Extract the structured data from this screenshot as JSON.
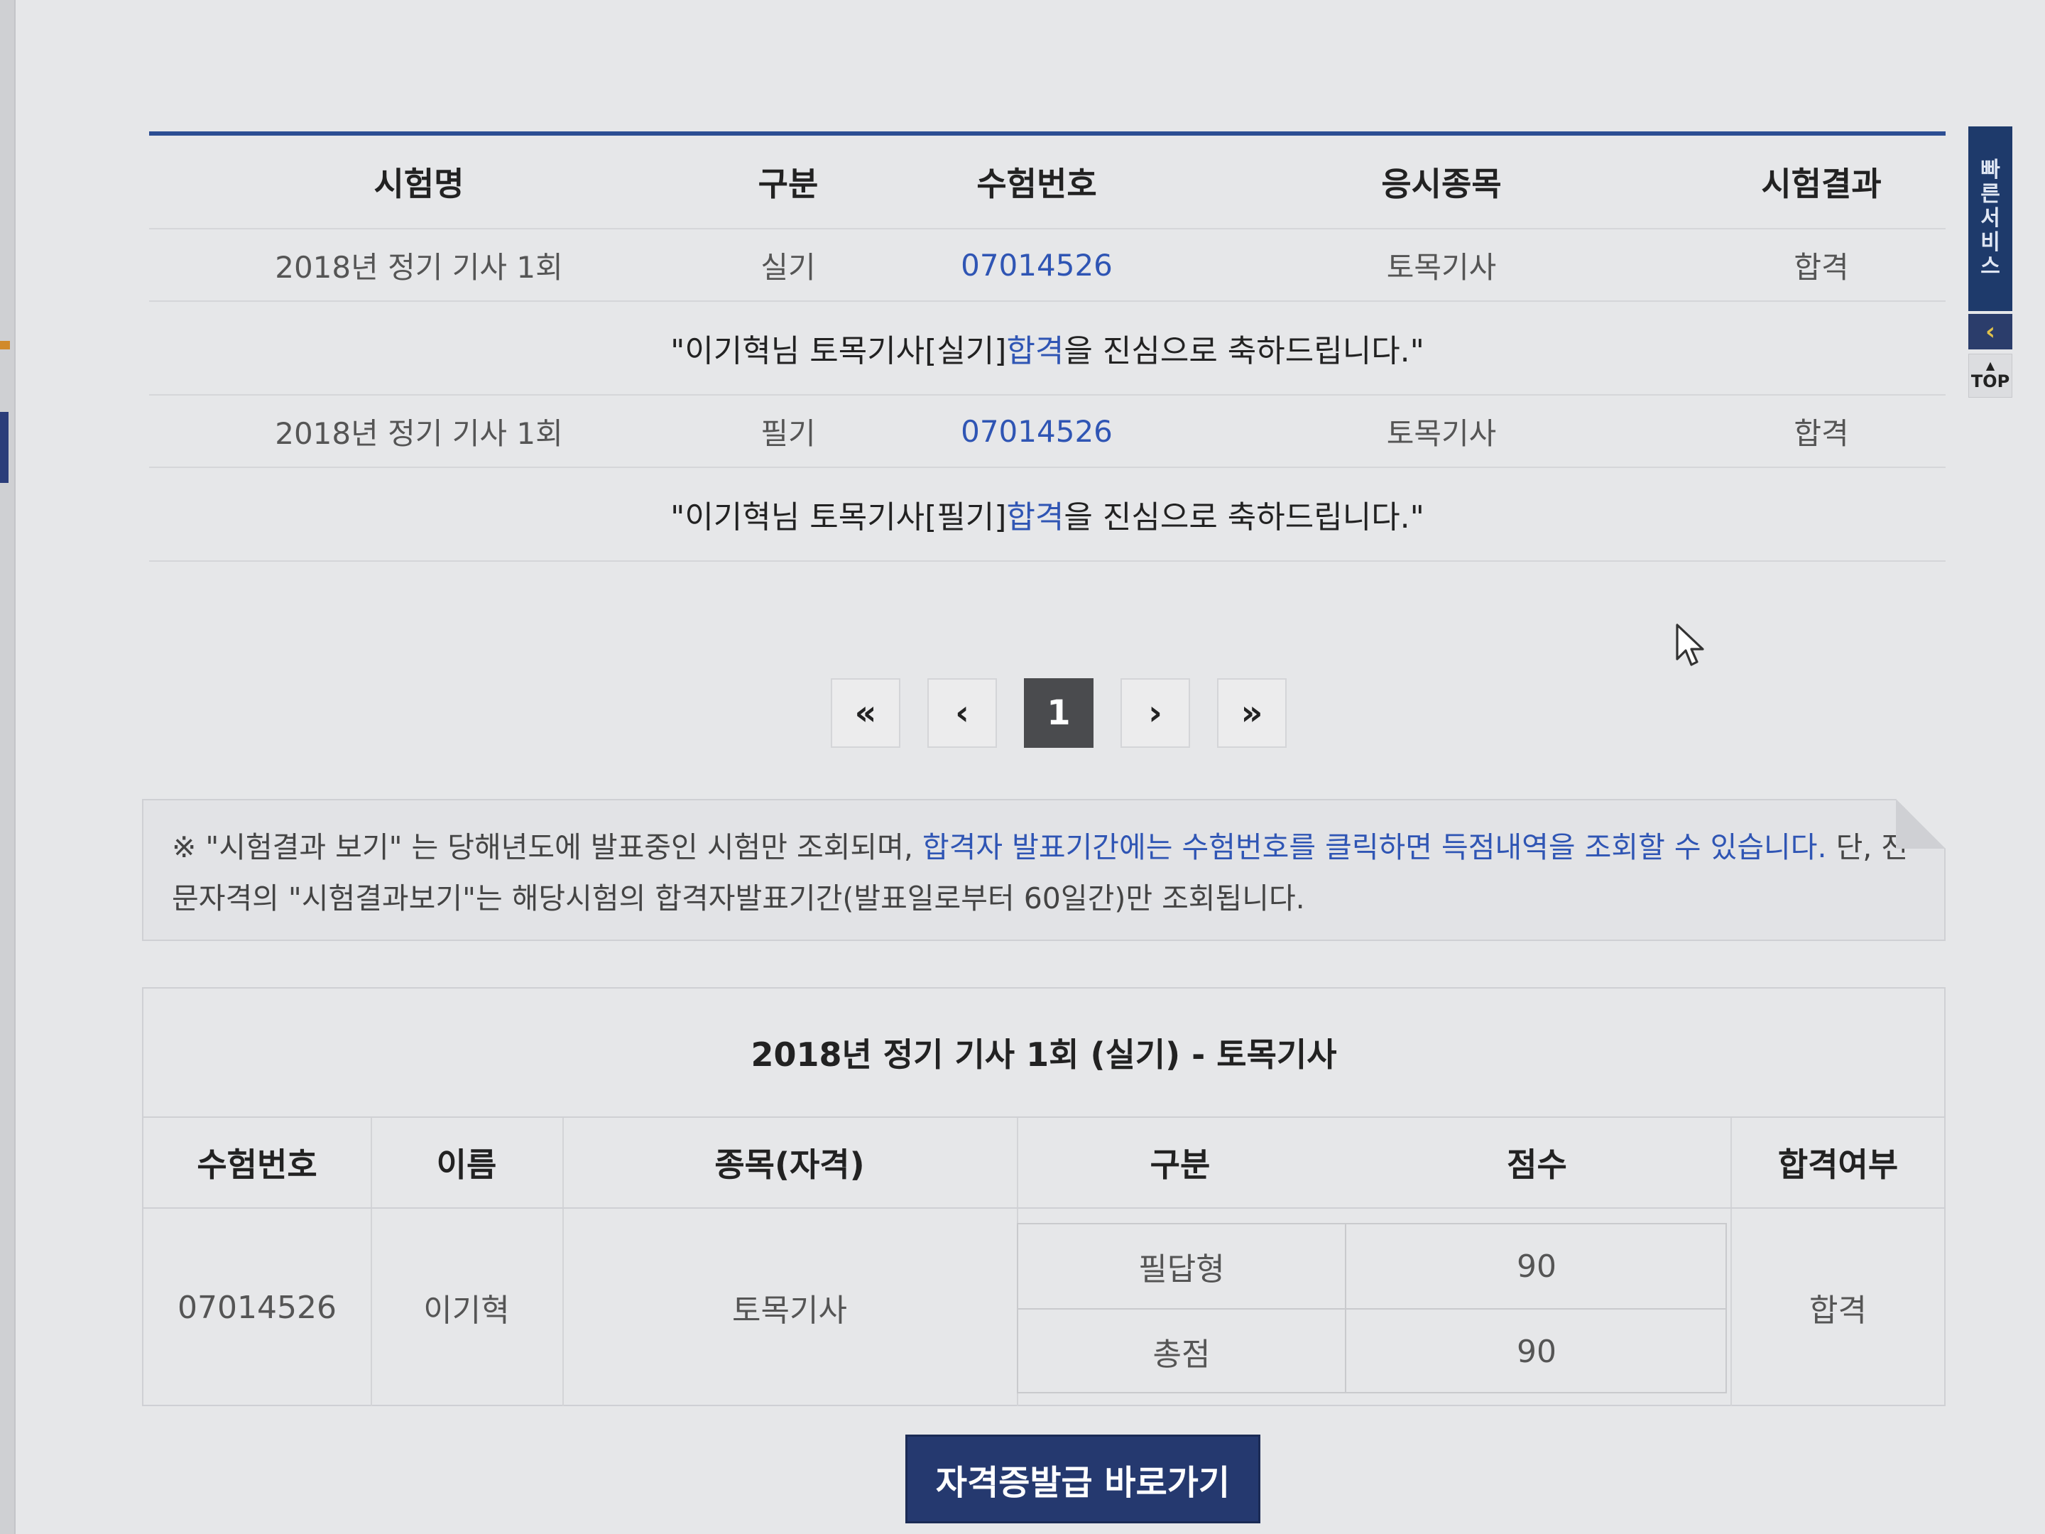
{
  "results": {
    "headers": [
      "시험명",
      "구분",
      "수험번호",
      "응시종목",
      "시험결과"
    ],
    "rows": [
      {
        "exam": "2018년 정기 기사 1회",
        "type": "실기",
        "reg_no": "07014526",
        "subject": "토목기사",
        "result": "합격",
        "msg_pre": "\"이기혁님 토목기사[실기] ",
        "msg_hl": "합격",
        "msg_post": "을 진심으로 축하드립니다.\""
      },
      {
        "exam": "2018년 정기 기사 1회",
        "type": "필기",
        "reg_no": "07014526",
        "subject": "토목기사",
        "result": "합격",
        "msg_pre": "\"이기혁님 토목기사[필기] ",
        "msg_hl": "합격",
        "msg_post": "을 진심으로 축하드립니다.\""
      }
    ]
  },
  "pagination": {
    "first": "«",
    "prev": "‹",
    "current": "1",
    "next": "›",
    "last": "»"
  },
  "notice": {
    "part1": "※ \"시험결과 보기\" 는 당해년도에 발표중인 시험만 조회되며, ",
    "part2_blue": "합격자 발표기간에는 수험번호를 클릭하면 득점내역을 조회할 수 있습니다.",
    "part3": " 단, 전문자격의 \"시험결과보기\"는 해당시험의 합격자발표기간(발표일로부터 60일간)만 조회됩니다."
  },
  "detail": {
    "title": "2018년 정기 기사 1회 (실기) - 토목기사",
    "headers": [
      "수험번호",
      "이름",
      "종목(자격)",
      "구분",
      "점수",
      "합격여부"
    ],
    "reg_no": "07014526",
    "name": "이기혁",
    "subject": "토목기사",
    "scores": [
      {
        "type": "필답형",
        "score": "90"
      },
      {
        "type": "총점",
        "score": "90"
      }
    ],
    "pass": "합격"
  },
  "issue_button": "자격증발급 바로가기",
  "quick": {
    "label_chars": [
      "빠",
      "른",
      "서",
      "비",
      "스"
    ],
    "arrow": "‹",
    "top_arrow": "▲",
    "top_label": "TOP"
  }
}
